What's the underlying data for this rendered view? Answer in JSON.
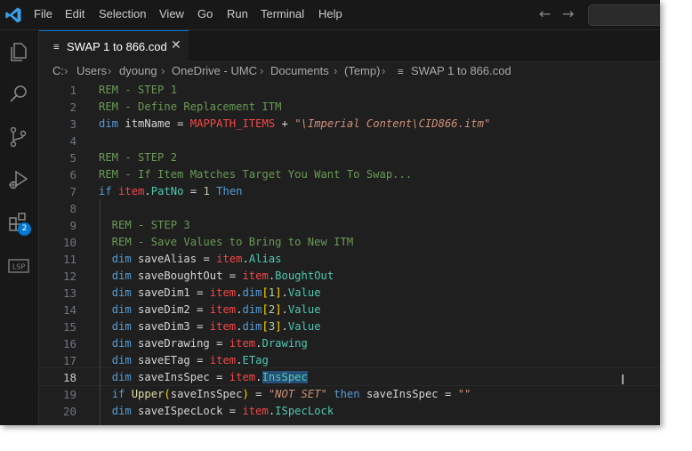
{
  "menu": [
    "File",
    "Edit",
    "Selection",
    "View",
    "Go",
    "Run",
    "Terminal",
    "Help"
  ],
  "tab": {
    "icon": "≡",
    "label": "SWAP 1 to 866.cod",
    "close": "✕"
  },
  "breadcrumb": [
    "C:",
    "Users",
    "dyoung",
    "OneDrive - UMC",
    "Documents",
    "(Temp)",
    "SWAP 1 to 866.cod"
  ],
  "breadcrumb_file_icon": "≡",
  "activity_badge": "2",
  "activity_icons": [
    "explorer-icon",
    "search-icon",
    "source-control-icon",
    "run-debug-icon",
    "extensions-icon",
    "lsp-icon"
  ],
  "current_line": 18,
  "lines": [
    {
      "n": "1",
      "t": "REM - STEP 1"
    },
    {
      "n": "2",
      "t": "REM - Define Replacement ITM"
    },
    {
      "n": "3",
      "t": "dim itmName = MAPPATH_ITEMS + \"\\Imperial Content\\CID866.itm\""
    },
    {
      "n": "4",
      "t": ""
    },
    {
      "n": "5",
      "t": "REM - STEP 2"
    },
    {
      "n": "6",
      "t": "REM - If Item Matches Target You Want To Swap..."
    },
    {
      "n": "7",
      "t": "if item.PatNo = 1 Then"
    },
    {
      "n": "8",
      "t": ""
    },
    {
      "n": "9",
      "t": "  REM - STEP 3"
    },
    {
      "n": "10",
      "t": "  REM - Save Values to Bring to New ITM"
    },
    {
      "n": "11",
      "t": "  dim saveAlias = item.Alias"
    },
    {
      "n": "12",
      "t": "  dim saveBoughtOut = item.BoughtOut"
    },
    {
      "n": "13",
      "t": "  dim saveDim1 = item.dim[1].Value"
    },
    {
      "n": "14",
      "t": "  dim saveDim2 = item.dim[2].Value"
    },
    {
      "n": "15",
      "t": "  dim saveDim3 = item.dim[3].Value"
    },
    {
      "n": "16",
      "t": "  dim saveDrawing = item.Drawing"
    },
    {
      "n": "17",
      "t": "  dim saveETag = item.ETag"
    },
    {
      "n": "18",
      "t": "  dim saveInsSpec = item.InsSpec"
    },
    {
      "n": "19",
      "t": "  if Upper(saveInsSpec) = \"NOT SET\" then saveInsSpec = \"\""
    },
    {
      "n": "20",
      "t": "  dim saveISpecLock = item.ISpecLock"
    }
  ],
  "colors": {
    "keyword": "#569cd6",
    "comment": "#6a9955",
    "constant": "#f44747",
    "string": "#ce9178",
    "number": "#b5cea8",
    "property": "#4ec9b0",
    "function": "#dcdcaa"
  }
}
